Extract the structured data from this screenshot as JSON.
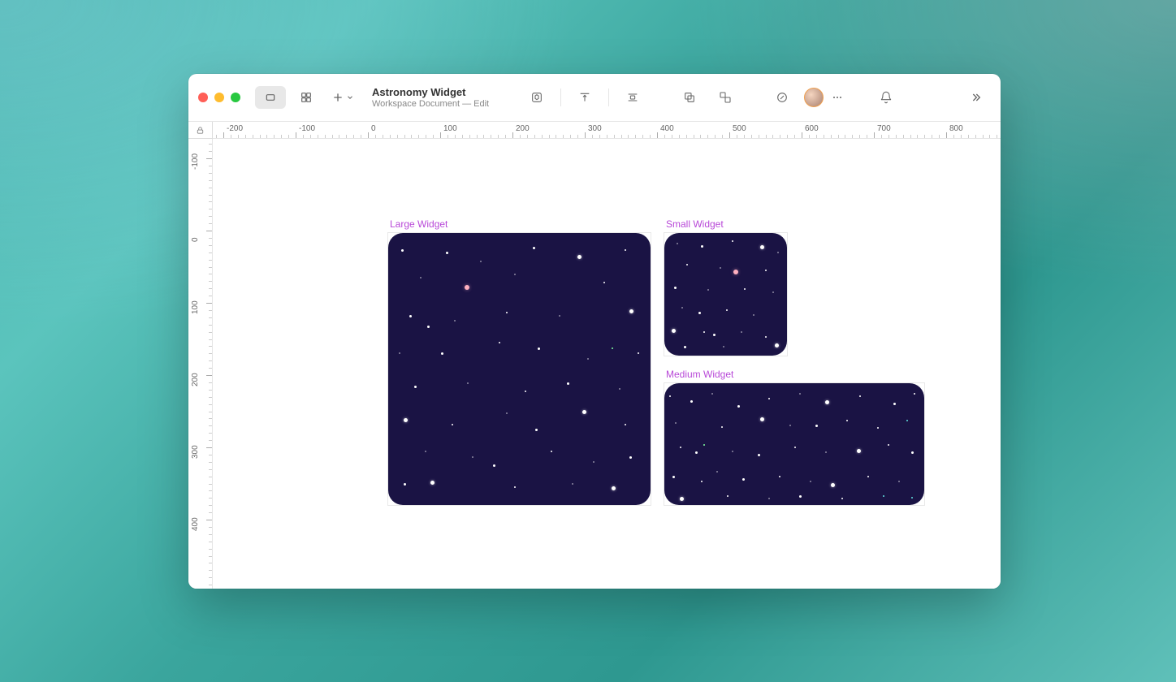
{
  "document": {
    "title": "Astronomy Widget",
    "subtitle": "Workspace Document — Edit"
  },
  "ruler_h": [
    "-200",
    "-100",
    "0",
    "100",
    "200",
    "300",
    "400",
    "500",
    "600",
    "700",
    "800"
  ],
  "ruler_v": [
    "-100",
    "0",
    "100",
    "200",
    "300",
    "400"
  ],
  "artboards": {
    "large": {
      "label": "Large Widget"
    },
    "small": {
      "label": "Small Widget"
    },
    "medium": {
      "label": "Medium Widget"
    }
  }
}
